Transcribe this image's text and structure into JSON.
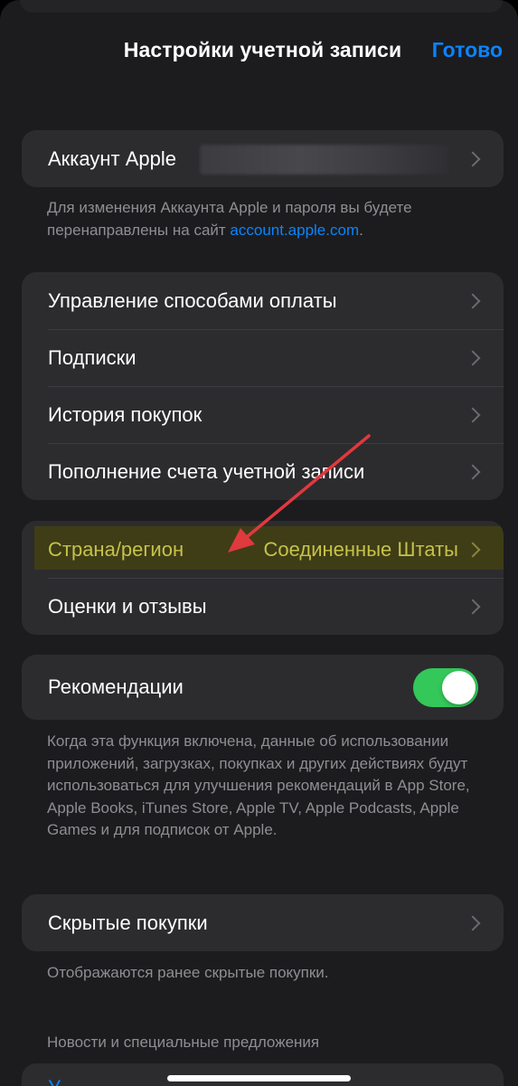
{
  "header": {
    "title": "Настройки учетной записи",
    "done_label": "Готово"
  },
  "account": {
    "label": "Аккаунт Apple",
    "note_text": "Для изменения Аккаунта Apple и пароля вы будете перенаправлены на сайт ",
    "note_link": "account.apple.com",
    "note_end": "."
  },
  "purchases_group": {
    "items": [
      {
        "label": "Управление способами оплаты"
      },
      {
        "label": "Подписки"
      },
      {
        "label": "История покупок"
      },
      {
        "label": "Пополнение счета учетной записи"
      }
    ]
  },
  "region_group": {
    "country_label": "Страна/регион",
    "country_value": "Соединенные Штаты",
    "ratings_label": "Оценки и отзывы"
  },
  "recommendations": {
    "label": "Рекомендации",
    "toggle_on": true,
    "note": "Когда эта функция включена, данные об использовании приложений, загрузках, покупках и других действиях будут использоваться для улучшения рекомендаций в App Store, Apple Books, iTunes Store, Apple TV, Apple Podcasts, Apple Games и для подписок от Apple."
  },
  "hidden_purchases": {
    "label": "Скрытые покупки",
    "note": "Отображаются ранее скрытые покупки."
  },
  "news": {
    "section_header": "Новости и специальные предложения",
    "peek_text": "У"
  },
  "colors": {
    "background": "#1c1c1e",
    "cell": "#2c2c2e",
    "accent_blue": "#0a84ff",
    "toggle_green": "#34c759",
    "highlight": "#3f3d16",
    "annotation_arrow": "#e0393e"
  }
}
